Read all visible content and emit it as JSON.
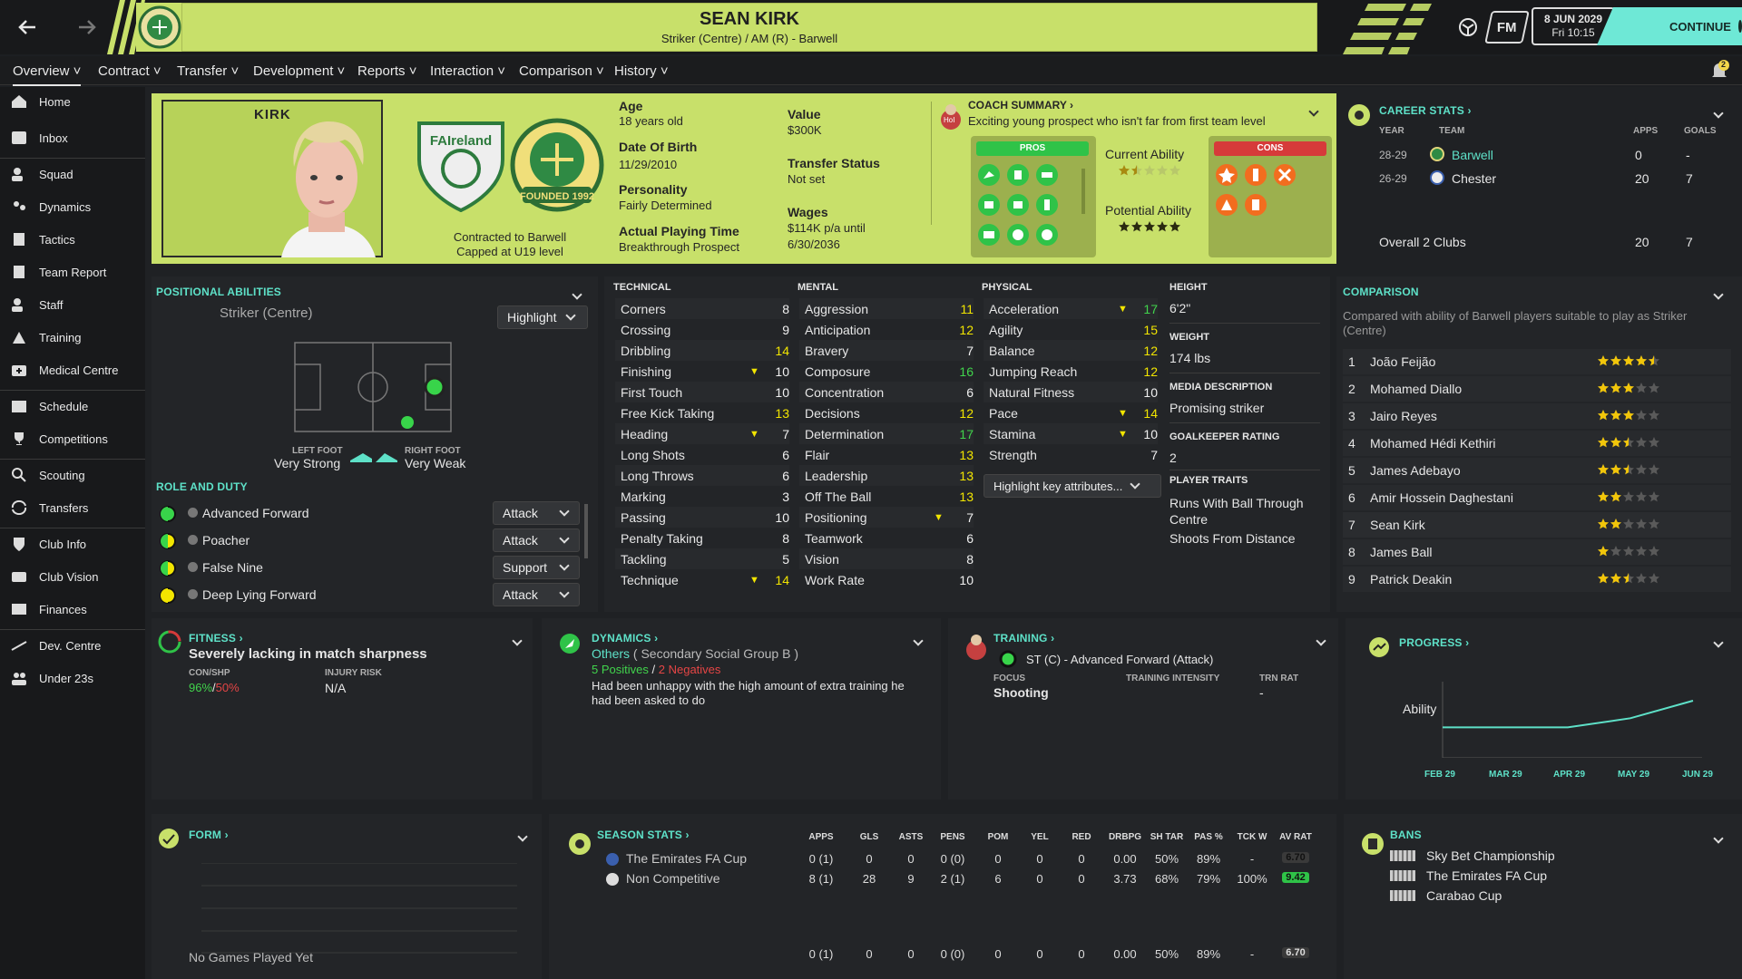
{
  "header": {
    "name": "SEAN KIRK",
    "subtitle": "Striker (Centre) / AM (R) - Barwell",
    "date": "8 JUN 2029",
    "time": "Fri 10:15",
    "fm": "FM",
    "continue": "CONTINUE",
    "notif": "2"
  },
  "menu": [
    "Overview",
    "Contract",
    "Transfer",
    "Development",
    "Reports",
    "Interaction",
    "Comparison",
    "History"
  ],
  "sidebar": [
    "Home",
    "Inbox",
    "Squad",
    "Dynamics",
    "Tactics",
    "Team Report",
    "Staff",
    "Training",
    "Medical Centre",
    "Schedule",
    "Competitions",
    "Scouting",
    "Transfers",
    "Club Info",
    "Club Vision",
    "Finances",
    "Dev. Centre",
    "Under 23s"
  ],
  "profile": {
    "shirt_name": "KIRK",
    "nation_badge": "FAIreland",
    "club_badge": "FOUNDED 1992",
    "contract": "Contracted to Barwell",
    "capped": "Capped at U19 level",
    "age_l": "Age",
    "age": "18 years old",
    "dob_l": "Date Of Birth",
    "dob": "11/29/2010",
    "pers_l": "Personality",
    "pers": "Fairly Determined",
    "apt_l": "Actual Playing Time",
    "apt": "Breakthrough Prospect",
    "value_l": "Value",
    "value": "$300K",
    "ts_l": "Transfer Status",
    "ts": "Not set",
    "wages_l": "Wages",
    "wages1": "$114K p/a until",
    "wages2": "6/30/2036"
  },
  "coach": {
    "title": "COACH SUMMARY",
    "text": "Exciting young prospect who isn't far from first team level",
    "hoi": "HoI",
    "pros": "PROS",
    "cons": "CONS",
    "ca": "Current Ability",
    "pa": "Potential Ability",
    "ca_stars": 1.5,
    "pa_stars": 5
  },
  "career": {
    "title": "CAREER STATS",
    "cols": [
      "YEAR",
      "TEAM",
      "APPS",
      "GOALS"
    ],
    "rows": [
      {
        "year": "28-29",
        "team": "Barwell",
        "apps": "0",
        "goals": "-"
      },
      {
        "year": "26-29",
        "team": "Chester",
        "apps": "20",
        "goals": "7"
      }
    ],
    "total": {
      "label": "Overall 2 Clubs",
      "apps": "20",
      "goals": "7"
    }
  },
  "positional": {
    "title": "POSITIONAL ABILITIES",
    "position": "Striker (Centre)",
    "highlight": "Highlight",
    "lf_l": "LEFT FOOT",
    "lf": "Very Strong",
    "rf_l": "RIGHT FOOT",
    "rf": "Very Weak"
  },
  "roles": {
    "title": "ROLE AND DUTY",
    "items": [
      {
        "name": "Advanced Forward",
        "duty": "Attack"
      },
      {
        "name": "Poacher",
        "duty": "Attack"
      },
      {
        "name": "False Nine",
        "duty": "Support"
      },
      {
        "name": "Deep Lying Forward",
        "duty": "Attack"
      }
    ]
  },
  "technical": {
    "title": "TECHNICAL",
    "items": [
      {
        "n": "Corners",
        "v": "8"
      },
      {
        "n": "Crossing",
        "v": "9"
      },
      {
        "n": "Dribbling",
        "v": "14"
      },
      {
        "n": "Finishing",
        "v": "10",
        "arrow": 1
      },
      {
        "n": "First Touch",
        "v": "10"
      },
      {
        "n": "Free Kick Taking",
        "v": "13"
      },
      {
        "n": "Heading",
        "v": "7",
        "arrow": 1
      },
      {
        "n": "Long Shots",
        "v": "6"
      },
      {
        "n": "Long Throws",
        "v": "6"
      },
      {
        "n": "Marking",
        "v": "3"
      },
      {
        "n": "Passing",
        "v": "10"
      },
      {
        "n": "Penalty Taking",
        "v": "8"
      },
      {
        "n": "Tackling",
        "v": "5"
      },
      {
        "n": "Technique",
        "v": "14",
        "arrow": 1
      }
    ]
  },
  "mental": {
    "title": "MENTAL",
    "items": [
      {
        "n": "Aggression",
        "v": "11"
      },
      {
        "n": "Anticipation",
        "v": "12"
      },
      {
        "n": "Bravery",
        "v": "7"
      },
      {
        "n": "Composure",
        "v": "16"
      },
      {
        "n": "Concentration",
        "v": "6"
      },
      {
        "n": "Decisions",
        "v": "12"
      },
      {
        "n": "Determination",
        "v": "17"
      },
      {
        "n": "Flair",
        "v": "13"
      },
      {
        "n": "Leadership",
        "v": "13"
      },
      {
        "n": "Off The Ball",
        "v": "13"
      },
      {
        "n": "Positioning",
        "v": "7",
        "arrow": 1
      },
      {
        "n": "Teamwork",
        "v": "6"
      },
      {
        "n": "Vision",
        "v": "8"
      },
      {
        "n": "Work Rate",
        "v": "10"
      }
    ]
  },
  "physical": {
    "title": "PHYSICAL",
    "items": [
      {
        "n": "Acceleration",
        "v": "17",
        "arrow": 1
      },
      {
        "n": "Agility",
        "v": "15"
      },
      {
        "n": "Balance",
        "v": "12"
      },
      {
        "n": "Jumping Reach",
        "v": "12"
      },
      {
        "n": "Natural Fitness",
        "v": "10"
      },
      {
        "n": "Pace",
        "v": "14",
        "arrow": 1
      },
      {
        "n": "Stamina",
        "v": "10",
        "arrow": 1
      },
      {
        "n": "Strength",
        "v": "7"
      }
    ],
    "highlight": "Highlight key attributes..."
  },
  "info": {
    "height_l": "HEIGHT",
    "height": "6'2\"",
    "weight_l": "WEIGHT",
    "weight": "174 lbs",
    "media_l": "MEDIA DESCRIPTION",
    "media": "Promising striker",
    "gk_l": "GOALKEEPER RATING",
    "gk": "2",
    "traits_l": "PLAYER TRAITS",
    "trait1a": "Runs With Ball Through",
    "trait1b": "Centre",
    "trait2": "Shoots From Distance"
  },
  "comparison": {
    "title": "COMPARISON",
    "desc1": "Compared with ability of Barwell players suitable to play as Striker",
    "desc2": "(Centre)",
    "rows": [
      {
        "r": "1",
        "n": "João Feijão",
        "s": 4.5
      },
      {
        "r": "2",
        "n": "Mohamed Diallo",
        "s": 3
      },
      {
        "r": "3",
        "n": "Jairo Reyes",
        "s": 3
      },
      {
        "r": "4",
        "n": "Mohamed Hédi Kethiri",
        "s": 2.5
      },
      {
        "r": "5",
        "n": "James Adebayo",
        "s": 2.5
      },
      {
        "r": "6",
        "n": "Amir Hossein Daghestani",
        "s": 2
      },
      {
        "r": "7",
        "n": "Sean Kirk",
        "s": 2
      },
      {
        "r": "8",
        "n": "James Ball",
        "s": 1
      },
      {
        "r": "9",
        "n": "Patrick Deakin",
        "s": 2.5
      }
    ]
  },
  "fitness": {
    "title": "FITNESS",
    "status": "Severely lacking in match sharpness",
    "con_l": "CON/SHP",
    "con": "96%",
    "shp": "50%",
    "inj_l": "INJURY RISK",
    "inj": "N/A"
  },
  "dynamics": {
    "title": "DYNAMICS",
    "group": "Others",
    "groupsub": "( Secondary Social Group B )",
    "pos": "5 Positives",
    "slash": "/",
    "neg": "2 Negatives",
    "text1": "Had been unhappy with the high amount of extra training he",
    "text2": "had been asked to do"
  },
  "training": {
    "title": "TRAINING",
    "role": "ST (C) - Advanced Forward (Attack)",
    "focus_l": "FOCUS",
    "focus": "Shooting",
    "ti_l": "TRAINING INTENSITY",
    "trn_l": "TRN RAT",
    "trn": "-"
  },
  "progress": {
    "title": "PROGRESS",
    "label": "Ability",
    "months": [
      "FEB 29",
      "MAR 29",
      "APR 29",
      "MAY 29",
      "JUN 29"
    ],
    "values": [
      40,
      40,
      40,
      52,
      75
    ]
  },
  "form": {
    "title": "FORM",
    "empty": "No Games Played Yet"
  },
  "season": {
    "title": "SEASON STATS",
    "cols": [
      "APPS",
      "GLS",
      "ASTS",
      "PENS",
      "POM",
      "YEL",
      "RED",
      "DRBPG",
      "SH TAR",
      "PAS %",
      "TCK W",
      "AV RAT"
    ],
    "rows": [
      {
        "comp": "The Emirates FA Cup",
        "vals": [
          "0 (1)",
          "0",
          "0",
          "0 (0)",
          "0",
          "0",
          "0",
          "0.00",
          "50%",
          "89%",
          "-",
          "6.70"
        ]
      },
      {
        "comp": "Non Competitive",
        "vals": [
          "8 (1)",
          "28",
          "9",
          "2 (1)",
          "6",
          "0",
          "0",
          "3.73",
          "68%",
          "79%",
          "100%",
          "9.42"
        ]
      }
    ],
    "total": [
      "0 (1)",
      "0",
      "0",
      "0 (0)",
      "0",
      "0",
      "0",
      "0.00",
      "50%",
      "89%",
      "-",
      "6.70"
    ]
  },
  "bans": {
    "title": "BANS",
    "items": [
      "Sky Bet Championship",
      "The Emirates FA Cup",
      "Carabao Cup"
    ]
  }
}
